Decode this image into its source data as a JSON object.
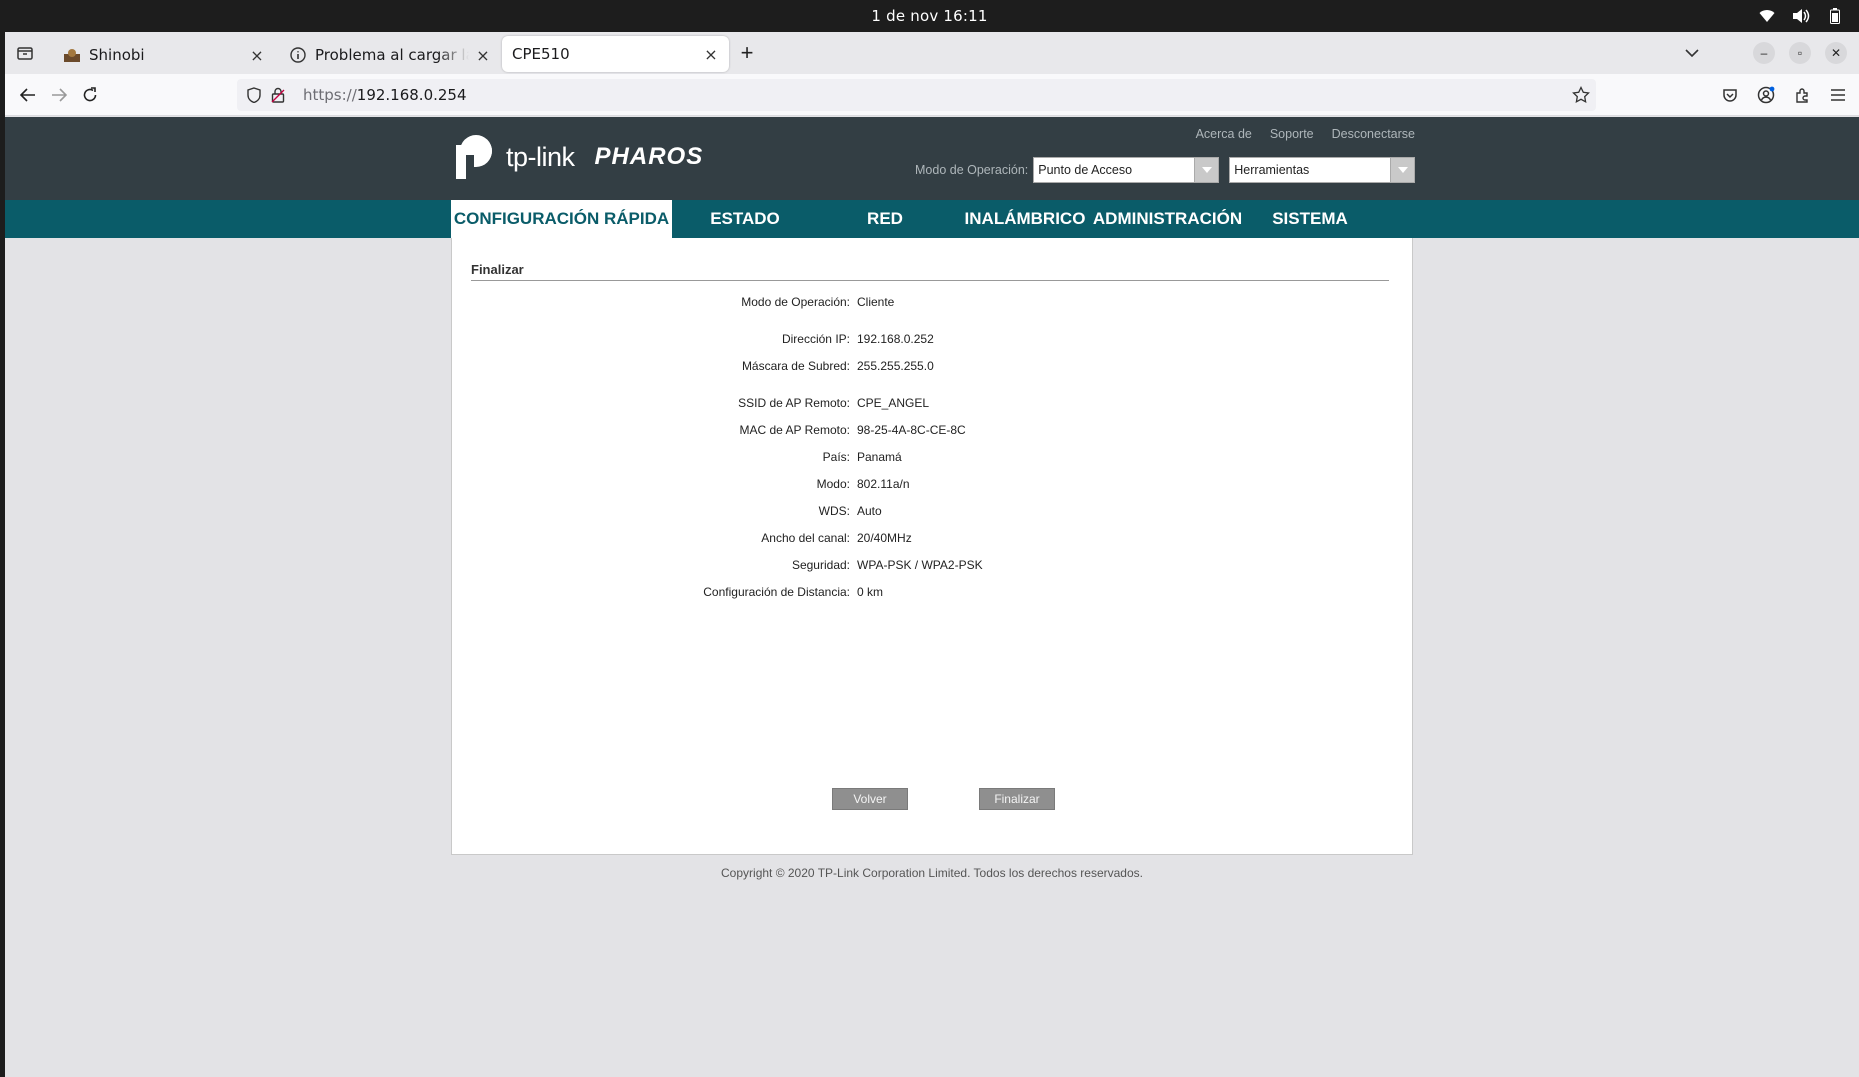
{
  "os": {
    "clock": "1 de nov  16:11",
    "icons": [
      "wifi-icon",
      "volume-icon",
      "battery-icon"
    ]
  },
  "browser": {
    "tabs": [
      {
        "title": "Shinobi",
        "icon": "shinobi-favicon"
      },
      {
        "title": "Problema al cargar la página",
        "icon": "info-icon"
      },
      {
        "title": "CPE510",
        "icon": ""
      }
    ],
    "url_scheme": "https://",
    "url_host": "192.168.0.254"
  },
  "header": {
    "brand": "tp-link",
    "product": "PHAROS",
    "links": {
      "about": "Acerca de",
      "support": "Soporte",
      "logout": "Desconectarse"
    },
    "opmode_label": "Modo de Operación:",
    "opmode_value": "Punto de Acceso",
    "tools_value": "Herramientas"
  },
  "nav": {
    "quick": "CONFIGURACIÓN RÁPIDA",
    "status": "ESTADO",
    "network": "RED",
    "wireless": "INALÁMBRICO",
    "admin": "ADMINISTRACIÓN",
    "system": "SISTEMA"
  },
  "summary": {
    "title": "Finalizar",
    "rows": [
      {
        "label": "Modo de Operación:",
        "value": "Cliente"
      },
      {
        "label": "Dirección IP:",
        "value": "192.168.0.252"
      },
      {
        "label": "Máscara de Subred:",
        "value": "255.255.255.0"
      },
      {
        "label": "SSID de AP Remoto:",
        "value": "CPE_ANGEL"
      },
      {
        "label": "MAC de AP Remoto:",
        "value": "98-25-4A-8C-CE-8C"
      },
      {
        "label": "País:",
        "value": "Panamá"
      },
      {
        "label": "Modo:",
        "value": "802.11a/n"
      },
      {
        "label": "WDS:",
        "value": "Auto"
      },
      {
        "label": "Ancho del canal:",
        "value": "20/40MHz"
      },
      {
        "label": "Seguridad:",
        "value": "WPA-PSK / WPA2-PSK"
      },
      {
        "label": "Configuración de Distancia:",
        "value": "0 km"
      }
    ],
    "back_button": "Volver",
    "finish_button": "Finalizar"
  },
  "footer": "Copyright © 2020 TP-Link Corporation Limited. Todos los derechos reservados.",
  "colors": {
    "header_bg": "#333e44",
    "nav_bg": "#0a5c69",
    "button_gray": "#8f8f8f"
  }
}
